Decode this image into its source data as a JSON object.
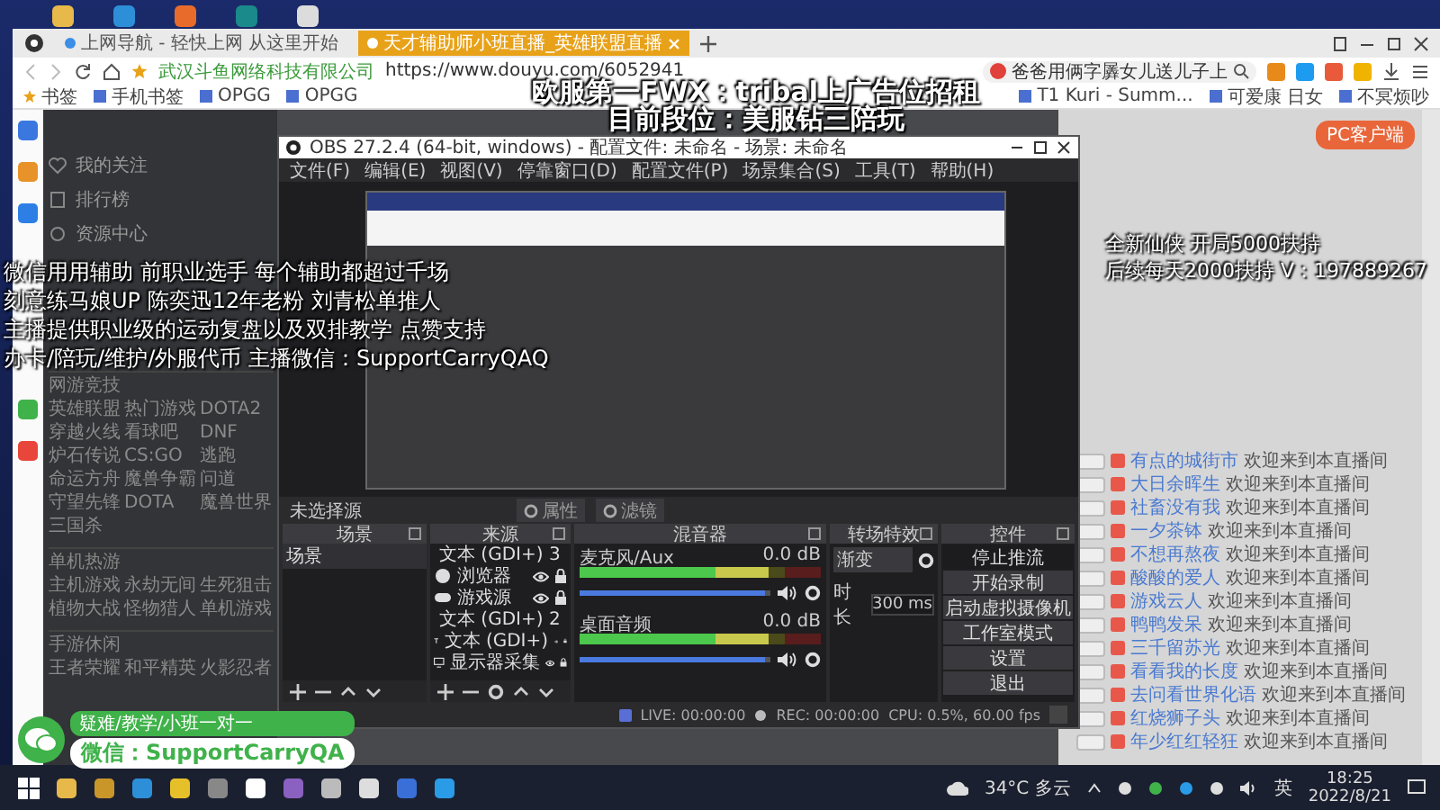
{
  "browser": {
    "tabs": [
      {
        "label": "上网导航 - 轻快上网 从这里开始",
        "selected": false
      },
      {
        "label": "天才辅助师小班直播_英雄联盟直播",
        "selected": true
      }
    ],
    "site_name": "武汉斗鱼网络科技有限公司",
    "url": "https://www.douyu.com/6052941",
    "search_text": "爸爸用俩字羼女儿送儿子上",
    "bookmarks_left": [
      "书签",
      "手机书签",
      "OPGG",
      "OPGG"
    ],
    "bookmarks_right": [
      "T1 Kuri - Summ...",
      "可爱康 日女",
      "不冥烦吵"
    ]
  },
  "nav": {
    "top_items": [
      "我的关注",
      "排行榜",
      "资源中心"
    ],
    "sections": [
      {
        "title": "网游竞技",
        "games": [
          "英雄联盟",
          "热门游戏",
          "DOTA2",
          "穿越火线",
          "看球吧",
          "DNF",
          "炉石传说",
          "CS:GO",
          "逃跑",
          "命运方舟",
          "魔兽争霸",
          "问道",
          "守望先锋",
          "DOTA",
          "魔兽世界",
          "三国杀"
        ]
      },
      {
        "title": "单机热游",
        "games": [
          "主机游戏",
          "永劫无间",
          "生死狙击",
          "植物大战",
          "怪物猎人",
          "单机游戏"
        ]
      },
      {
        "title": "手游休闲",
        "games": [
          "王者荣耀",
          "和平精英",
          "火影忍者"
        ]
      }
    ]
  },
  "obs": {
    "title": "OBS 27.2.4 (64-bit, windows) - 配置文件: 未命名 - 场景: 未命名",
    "menu": [
      "文件(F)",
      "编辑(E)",
      "视图(V)",
      "停靠窗口(D)",
      "配置文件(P)",
      "场景集合(S)",
      "工具(T)",
      "帮助(H)"
    ],
    "source_bar": {
      "label": "未选择源",
      "buttons": [
        "属性",
        "滤镜"
      ]
    },
    "docks": {
      "scenes": "场景",
      "sources": "来源",
      "mixer": "混音器",
      "transitions": "转场特效",
      "controls": "控件"
    },
    "scenes": [
      "场景"
    ],
    "sources": [
      {
        "kind": "text",
        "name": "文本 (GDI+) 3"
      },
      {
        "kind": "browser",
        "name": "浏览器"
      },
      {
        "kind": "game",
        "name": "游戏源"
      },
      {
        "kind": "text",
        "name": "文本 (GDI+) 2"
      },
      {
        "kind": "text",
        "name": "文本 (GDI+)"
      },
      {
        "kind": "display",
        "name": "显示器采集"
      }
    ],
    "mixer": [
      {
        "name": "麦克风/Aux",
        "reading": "0.0 dB",
        "level": 0.78,
        "volume": {
          "level": 0.97
        }
      },
      {
        "name": "桌面音频",
        "reading": "0.0 dB",
        "level": 0.78,
        "volume": {
          "level": 0.97
        }
      }
    ],
    "transition": {
      "type": "渐变",
      "duration_label": "时长",
      "duration": "300 ms"
    },
    "controls": [
      "停止推流",
      "开始录制",
      "启动虚拟摄像机",
      "工作室模式",
      "设置",
      "退出"
    ],
    "status": [
      "LIVE: 00:00:00",
      "REC: 00:00:00",
      "CPU: 0.5%, 60.00 fps"
    ]
  },
  "chat": {
    "client_button": "PC客户端",
    "messages": [
      {
        "user": "有点的城街市",
        "text": "欢迎来到本直播间"
      },
      {
        "user": "大日余晖生",
        "text": "欢迎来到本直播间"
      },
      {
        "user": "社畜没有我",
        "text": "欢迎来到本直播间"
      },
      {
        "user": "一夕茶钵",
        "text": "欢迎来到本直播间"
      },
      {
        "user": "不想再熬夜",
        "text": "欢迎来到本直播间"
      },
      {
        "user": "酸酸的爱人",
        "text": "欢迎来到本直播间"
      },
      {
        "user": "游戏云人",
        "text": "欢迎来到本直播间"
      },
      {
        "user": "鸭鸭发呆",
        "text": "欢迎来到本直播间"
      },
      {
        "user": "三千留苏光",
        "text": "欢迎来到本直播间"
      },
      {
        "user": "看看我的长度",
        "text": "欢迎来到本直播间"
      },
      {
        "user": "去问看世界化语",
        "text": "欢迎来到本直播间"
      },
      {
        "user": "红烧狮子头",
        "text": "欢迎来到本直播间"
      },
      {
        "user": "年少红红轻狂",
        "text": "欢迎来到本直播间"
      }
    ]
  },
  "overlays": {
    "top_lines": [
      "欧服第一FWX：tribal上广告位招租",
      "目前段位：美服钻三陪玩"
    ],
    "left_lines": [
      "微信用用辅助 前职业选手 每个辅助都超过千场",
      "刻意练马娘UP 陈奕迅12年老粉 刘青松单推人",
      "主播提供职业级的运动复盘以及双排教学 点赞支持",
      "办卡/陪玩/维护/外服代币 主播微信：SupportCarryQAQ"
    ],
    "right_lines": [
      "全新仙侠 开局5000扶持",
      "后续每天2000扶持 V：197889267"
    ],
    "wechat_badge": {
      "tag": "疑难/教学/小班一对一",
      "text": "微信：SupportCarryQA"
    }
  },
  "taskbar": {
    "weather": "34°C 多云",
    "input_method": "英",
    "time": "18:25",
    "date": "2022/8/21"
  }
}
